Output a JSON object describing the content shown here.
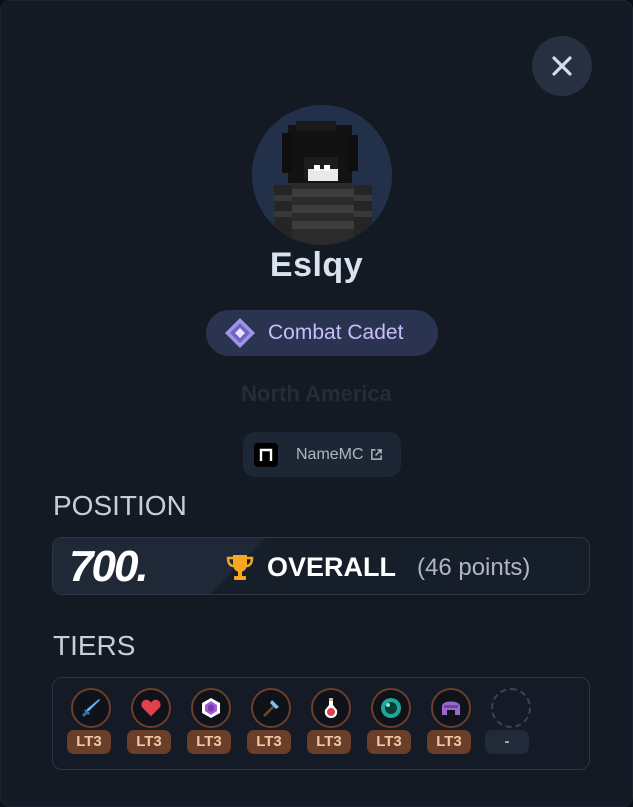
{
  "header": {
    "close_icon": "close-icon"
  },
  "profile": {
    "username": "Eslqy",
    "rank": "Combat Cadet",
    "region": "North America",
    "namemc_label": "NameMC"
  },
  "position": {
    "section_title": "POSITION",
    "rank_number": "700.",
    "category": "OVERALL",
    "points": "(46 points)"
  },
  "tiers": {
    "section_title": "TIERS",
    "items": [
      {
        "icon": "sword-icon",
        "label": "LT3"
      },
      {
        "icon": "heart-icon",
        "label": "LT3"
      },
      {
        "icon": "crystal-icon",
        "label": "LT3"
      },
      {
        "icon": "axe-icon",
        "label": "LT3"
      },
      {
        "icon": "potion-icon",
        "label": "LT3"
      },
      {
        "icon": "ender-pearl-icon",
        "label": "LT3"
      },
      {
        "icon": "netherite-helmet-icon",
        "label": "LT3"
      },
      {
        "icon": "empty-slot-icon",
        "label": "-"
      }
    ]
  },
  "colors": {
    "background": "#131a24",
    "rank_text": "#c7bdfb",
    "tier_badge": "#6a3f2a",
    "trophy": "#f5a623"
  }
}
